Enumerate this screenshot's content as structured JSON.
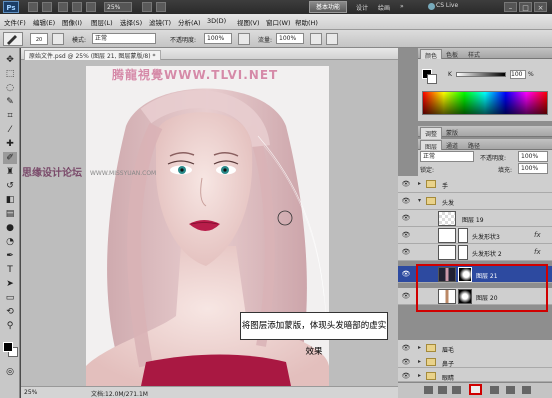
{
  "app": {
    "logo": "Ps",
    "zoom": "25%",
    "workspace_active": "基本功能",
    "workspace_links": [
      "设计",
      "绘画",
      "»"
    ],
    "cs_live": "CS Live",
    "window_buttons": [
      "–",
      "□",
      "×"
    ]
  },
  "menu": [
    "文件(F)",
    "编辑(E)",
    "图像(I)",
    "图层(L)",
    "选择(S)",
    "滤镜(T)",
    "分析(A)",
    "3D(D)",
    "视图(V)",
    "窗口(W)",
    "帮助(H)"
  ],
  "options": {
    "brush_size": "20",
    "mode_label": "模式:",
    "mode_value": "正常",
    "opacity_label": "不透明度:",
    "opacity_value": "100%",
    "flow_label": "流量:",
    "flow_value": "100%"
  },
  "document": {
    "tab_title": "原始文件.psd @ 25% (图层 21, 图层蒙版/8) *",
    "watermark_top": "腾龍視覺WWW.TLVI.NET",
    "watermark_left": "思缘设计论坛",
    "watermark_site": "WWW.MISSYUAN.COM",
    "callout": "将图层添加蒙版，体现头发暗部的虚实效果"
  },
  "status": {
    "zoom": "25%",
    "doc_info": "文档:12.0M/271.1M"
  },
  "color_panel": {
    "tabs": [
      "颜色",
      "色板",
      "样式"
    ],
    "k_label": "K",
    "k_value": "100",
    "k_unit": "%"
  },
  "adjust_panel": {
    "tabs": [
      "调整",
      "蒙版"
    ]
  },
  "layers_panel": {
    "tabs": [
      "图层",
      "通道",
      "路径"
    ],
    "blend_mode": "正常",
    "opacity_label": "不透明度:",
    "opacity_value": "100%",
    "lock_label": "锁定:",
    "fill_label": "填充:",
    "fill_value": "100%",
    "fx_label": "fx",
    "rows": [
      {
        "name": "手",
        "type": "folder"
      },
      {
        "name": "头发",
        "type": "folder"
      },
      {
        "name": "图层 19",
        "type": "layer"
      },
      {
        "name": "头发形状3",
        "type": "shape"
      },
      {
        "name": "头发形状 2",
        "type": "shape"
      },
      {
        "name": "图层 21",
        "type": "mask",
        "selected": true
      },
      {
        "name": "图层 20",
        "type": "mask"
      },
      {
        "name": "眉毛",
        "type": "folder"
      },
      {
        "name": "鼻子",
        "type": "folder"
      },
      {
        "name": "眼睛",
        "type": "folder"
      }
    ]
  },
  "colors": {
    "selection": "#2d4aa0",
    "highlight_box": "#d00000",
    "lips": "#b81d4a",
    "hair": "#d9b3b6",
    "skin": "#f1d9d6",
    "dress": "#a91842"
  }
}
